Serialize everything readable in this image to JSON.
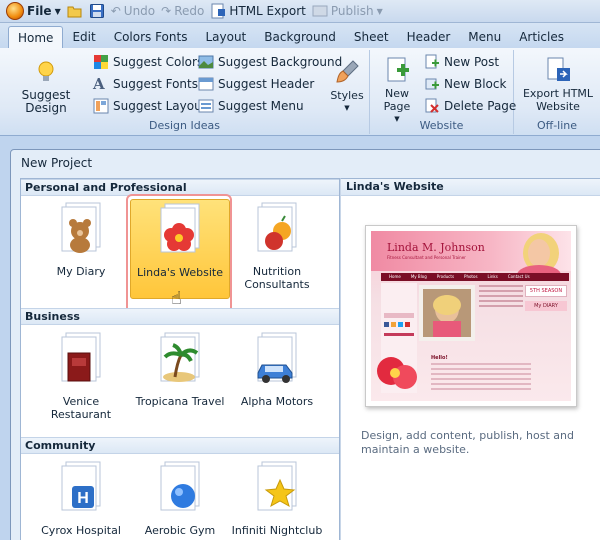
{
  "qat": {
    "file": "File",
    "undo": "Undo",
    "redo": "Redo",
    "html_export": "HTML Export",
    "publish": "Publish"
  },
  "tabs": [
    "Home",
    "Edit",
    "Colors Fonts",
    "Layout",
    "Background",
    "Sheet",
    "Header",
    "Menu",
    "Articles"
  ],
  "ribbon": {
    "suggest_design": "Suggest Design",
    "suggest_colors": "Suggest Colors",
    "suggest_fonts": "Suggest Fonts",
    "suggest_layout": "Suggest Layout",
    "suggest_background": "Suggest Background",
    "suggest_header": "Suggest Header",
    "suggest_menu": "Suggest Menu",
    "styles": "Styles",
    "design_ideas": "Design Ideas",
    "new_page": "New Page",
    "new_post": "New Post",
    "new_block": "New Block",
    "delete_page": "Delete Page",
    "website": "Website",
    "export_html": "Export HTML Website",
    "offline": "Off-line"
  },
  "dialog": {
    "title": "New Project",
    "categories": [
      {
        "name": "Personal and Professional",
        "items": [
          "My Diary",
          "Linda's Website",
          "Nutrition Consultants"
        ]
      },
      {
        "name": "Business",
        "items": [
          "Venice Restaurant",
          "Tropicana Travel",
          "Alpha Motors"
        ]
      },
      {
        "name": "Community",
        "items": [
          "Cyrox Hospital",
          "Aerobic Gym",
          "Infiniti Nightclub"
        ]
      }
    ],
    "selected_title": "Linda's Website",
    "preview": {
      "name": "Linda M. Johnson",
      "tagline": "Fitness Consultant and Personal Trainer",
      "nav": [
        "Home",
        "My Blog",
        "Products",
        "Photos",
        "Links",
        "Contact Us"
      ],
      "badge": "5TH SEASON",
      "diary": "My DIARY",
      "hello": "Hello!"
    },
    "description": "Design, add content, publish, host and maintain a website."
  }
}
